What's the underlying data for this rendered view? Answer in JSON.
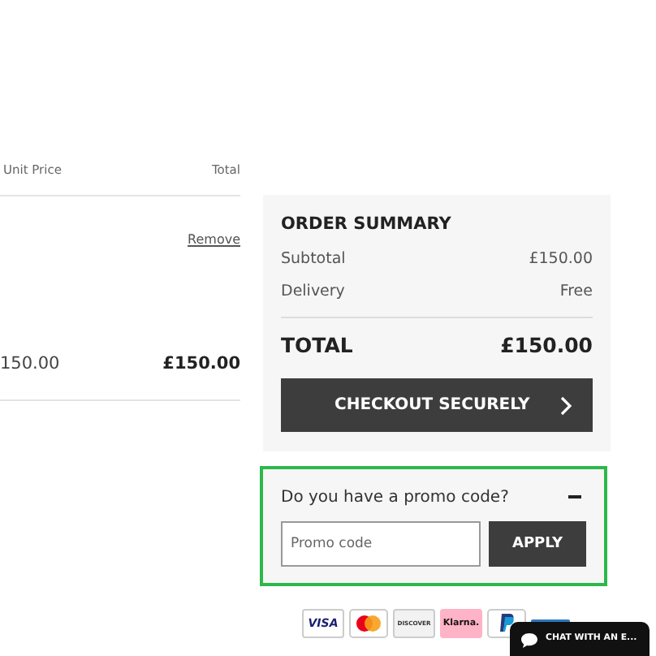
{
  "cart": {
    "columns": [
      "Unit Price",
      "Total"
    ],
    "item": {
      "remove_link": "Remove",
      "unit_price": "150.00",
      "total": "£150.00"
    }
  },
  "summary": {
    "title": "ORDER SUMMARY",
    "rows": [
      {
        "label": "Subtotal",
        "value": "£150.00"
      },
      {
        "label": "Delivery",
        "value": "Free"
      }
    ],
    "total_label": "TOTAL",
    "total_value": "£150.00",
    "checkout_button": "CHECKOUT SECURELY"
  },
  "promo": {
    "question": "Do you have a promo code?",
    "expanded": true,
    "placeholder": "Promo code",
    "apply_button": "APPLY"
  },
  "payment_methods": [
    {
      "kind": "visa",
      "label": "VISA"
    },
    {
      "kind": "mastercard"
    },
    {
      "kind": "discover",
      "label": "DISCOVER"
    },
    {
      "kind": "klarna",
      "label": "Klarna."
    },
    {
      "kind": "paypal"
    },
    {
      "kind": "amex"
    }
  ],
  "chat_button": "CHAT WITH AN E..."
}
